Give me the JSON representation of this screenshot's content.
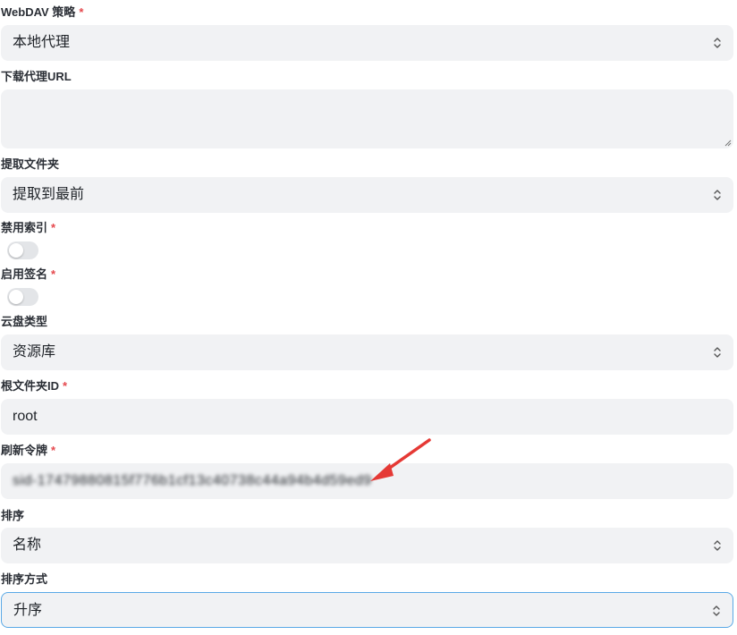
{
  "fields": {
    "webdav_policy": {
      "label": "WebDAV 策略",
      "required": "*",
      "value": "本地代理"
    },
    "download_proxy_url": {
      "label": "下载代理URL",
      "value": ""
    },
    "extract_folder": {
      "label": "提取文件夹",
      "value": "提取到最前"
    },
    "disable_index": {
      "label": "禁用索引",
      "required": "*",
      "state": "off"
    },
    "enable_sign": {
      "label": "启用签名",
      "required": "*",
      "state": "off"
    },
    "drive_type": {
      "label": "云盘类型",
      "value": "资源库"
    },
    "root_folder_id": {
      "label": "根文件夹ID",
      "required": "*",
      "value": "root"
    },
    "refresh_token": {
      "label": "刷新令牌",
      "required": "*",
      "value": "sid-17479880815f776b1cf13c40738c44a94b4d59ed9"
    },
    "order_by": {
      "label": "排序",
      "value": "名称"
    },
    "order_direction": {
      "label": "排序方式",
      "value": "升序"
    }
  },
  "colors": {
    "required": "#e5484d",
    "field_bg": "#f1f2f4",
    "focus_border": "#5aa9e6",
    "annotation_arrow": "#e53935"
  },
  "icons": [
    "chevron-updown-icon",
    "resize-grip-icon",
    "annotation-arrow"
  ]
}
